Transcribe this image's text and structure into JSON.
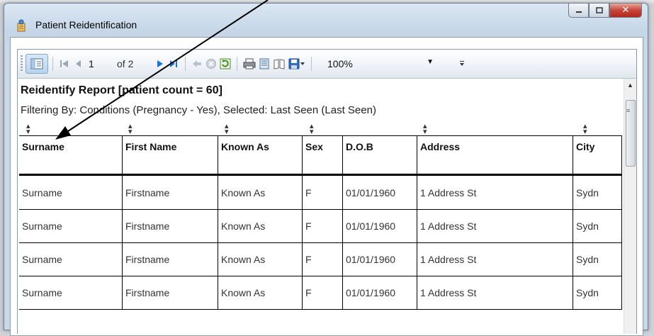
{
  "window": {
    "title": "Patient Reidentification"
  },
  "toolbar": {
    "page_current": "1",
    "page_of": "of 2",
    "zoom": "100%"
  },
  "report": {
    "title": "Reidentify Report  [patient count = 60]",
    "filter": "Filtering By: Conditions (Pregnancy - Yes), Selected: Last Seen (Last Seen)",
    "columns": [
      "Surname",
      "First Name",
      "Known As",
      "Sex",
      "D.O.B",
      "Address",
      "City"
    ],
    "rows": [
      [
        "Surname",
        "Firstname",
        "Known As",
        "F",
        "01/01/1960",
        "1 Address St",
        "Sydn"
      ],
      [
        "Surname",
        "Firstname",
        "Known As",
        "F",
        "01/01/1960",
        "1 Address St",
        "Sydn"
      ],
      [
        "Surname",
        "Firstname",
        "Known As",
        "F",
        "01/01/1960",
        "1 Address St",
        "Sydn"
      ],
      [
        "Surname",
        "Firstname",
        "Known As",
        "F",
        "01/01/1960",
        "1 Address St",
        "Sydn"
      ]
    ]
  },
  "colors": {
    "accent_blue": "#1a73d6",
    "close_red": "#c7453a"
  }
}
